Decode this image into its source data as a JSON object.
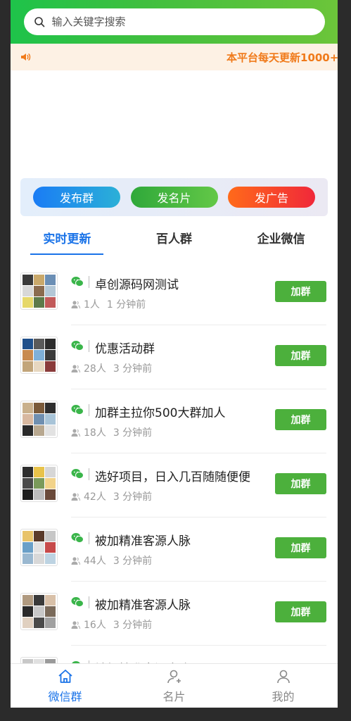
{
  "search": {
    "placeholder": "输入关键字搜索"
  },
  "notice": {
    "text": "本平台每天更新1000+"
  },
  "actions": [
    {
      "label": "发布群",
      "color": "#1a7cf5"
    },
    {
      "label": "发名片",
      "color": "#3aab3c"
    },
    {
      "label": "发广告",
      "color": "#f43a2e"
    }
  ],
  "tabs": [
    {
      "label": "实时更新",
      "active": true
    },
    {
      "label": "百人群",
      "active": false
    },
    {
      "label": "企业微信",
      "active": false
    }
  ],
  "groups": [
    {
      "title": "卓创源码网测试",
      "members": "1人",
      "time": "1 分钟前",
      "join": "加群"
    },
    {
      "title": "优惠活动群",
      "members": "28人",
      "time": "3 分钟前",
      "join": "加群"
    },
    {
      "title": "加群主拉你500大群加人",
      "members": "18人",
      "time": "3 分钟前",
      "join": "加群"
    },
    {
      "title": "选好项目，日入几百随随便便",
      "members": "42人",
      "time": "3 分钟前",
      "join": "加群"
    },
    {
      "title": "被加精准客源人脉",
      "members": "44人",
      "time": "3 分钟前",
      "join": "加群"
    },
    {
      "title": "被加精准客源人脉",
      "members": "16人",
      "time": "3 分钟前",
      "join": "加群"
    },
    {
      "title": "被加精准客源人脉",
      "members": "",
      "time": "",
      "join": ""
    }
  ],
  "bottom_nav": [
    {
      "label": "微信群",
      "icon": "home-icon",
      "active": true
    },
    {
      "label": "名片",
      "icon": "user-add-icon",
      "active": false
    },
    {
      "label": "我的",
      "icon": "user-icon",
      "active": false
    }
  ],
  "colors": {
    "accent": "#1a73e8",
    "join_button": "#4cb03c",
    "notice_text": "#f07a1a",
    "header_green": "#3fbf3f"
  }
}
